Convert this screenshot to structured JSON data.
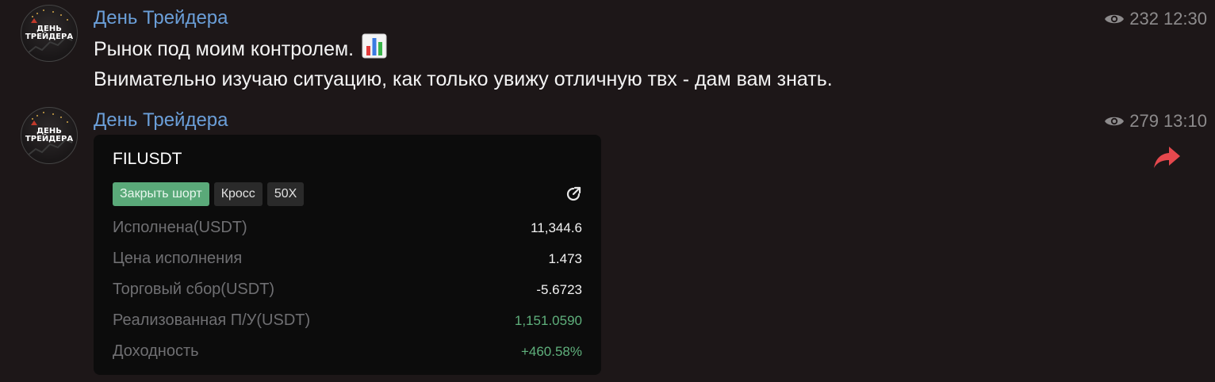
{
  "messages": [
    {
      "sender": "День Трейдера",
      "views": "232",
      "time": "12:30",
      "lines": [
        "Рынок под моим контролем.",
        "Внимательно изучаю ситуацию, как только увижу отличную твх - дам вам знать."
      ],
      "emoji": "bar-chart-emoji"
    },
    {
      "sender": "День Трейдера",
      "views": "279",
      "time": "13:10",
      "card": {
        "pair": "FILUSDT",
        "tags": [
          "Закрыть шорт",
          "Кросс",
          "50X"
        ],
        "rows": [
          {
            "label": "Исполнена(USDT)",
            "value": "11,344.6"
          },
          {
            "label": "Цена исполнения",
            "value": "1.473"
          },
          {
            "label": "Торговый сбор(USDT)",
            "value": "-5.6723"
          },
          {
            "label": "Реализованная П/У(USDT)",
            "value": "1,151.0590"
          },
          {
            "label": "Доходность",
            "value": "+460.58%"
          }
        ]
      }
    }
  ],
  "avatar": {
    "logo_text": "ДЕНЬ\nТРЕЙДЕРА"
  },
  "colors": {
    "background": "#1d1718",
    "sender": "#6b9fd9",
    "meta": "#8d8b8c",
    "card_bg": "#0c0c0c",
    "profit_green": "#5fb07c",
    "tag_green": "#5aa979",
    "forward_red": "#e5484d"
  },
  "icons": [
    "eye-icon",
    "share-icon",
    "forward-arrow-icon",
    "bar-chart-emoji"
  ]
}
